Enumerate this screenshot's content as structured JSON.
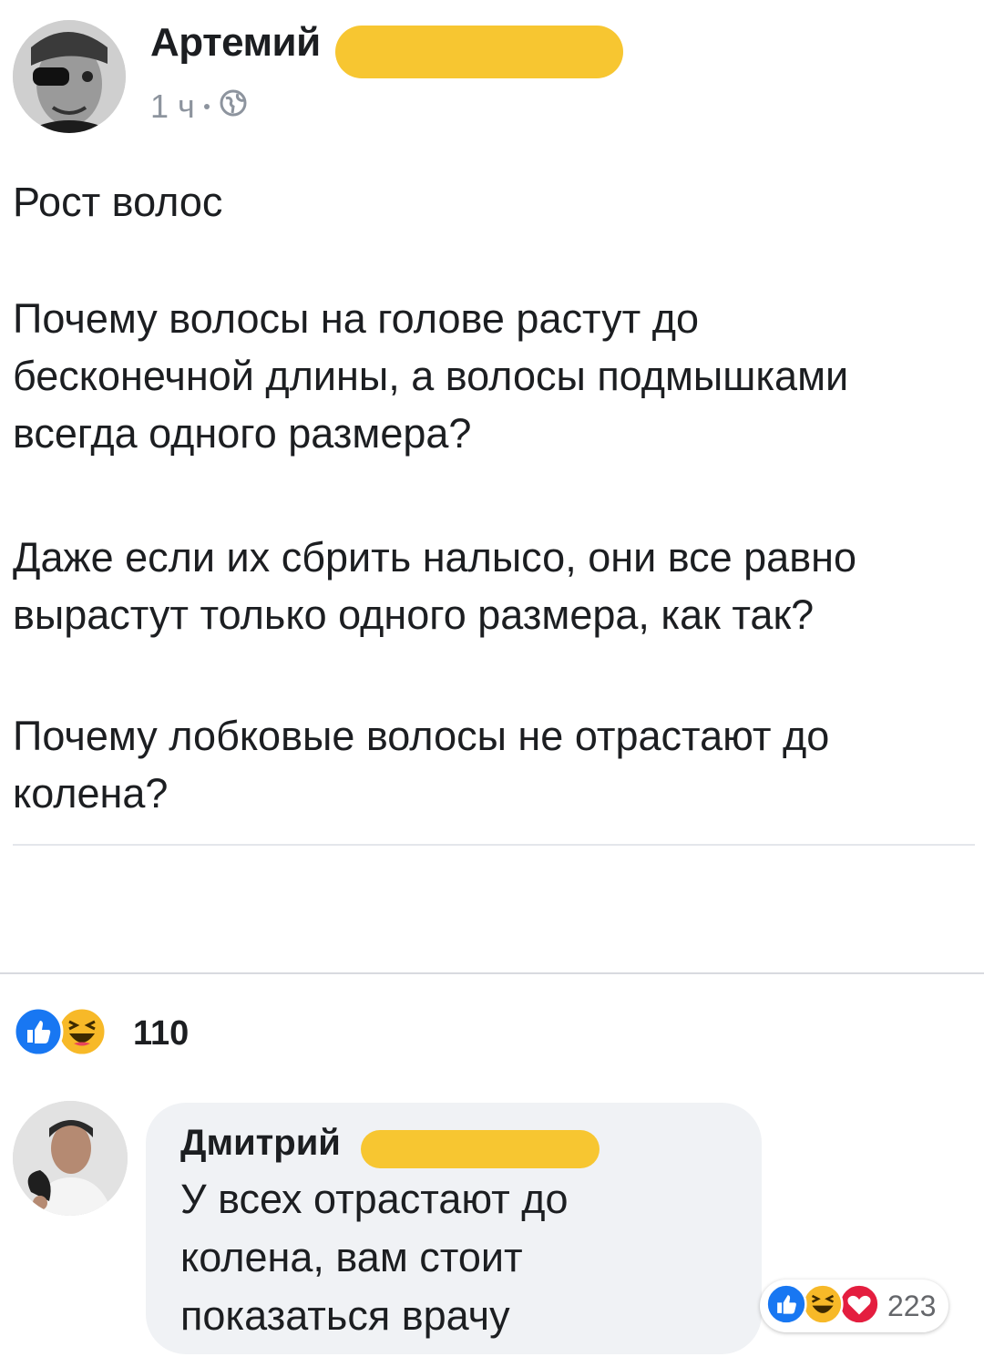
{
  "post": {
    "author": "Артемий",
    "time": "1 ч",
    "title": "Рост волос",
    "paragraphs": [
      "Почему волосы на голове растут до\nбесконечной длины, а волосы подмышками\nвсегда одного размера?",
      "Даже если их сбрить налысо, они все равно\nвырастут только одного размера, как так?",
      "Почему лобковые волосы не отрастают до\nколена?"
    ],
    "reaction_count": "110",
    "reaction_icons": [
      "like-icon",
      "haha-icon"
    ]
  },
  "comment": {
    "author": "Дмитрий",
    "text": "У всех отрастают до\nколена, вам стоит\nпоказаться врачу",
    "reaction_count": "223",
    "reaction_icons": [
      "like-icon",
      "haha-icon",
      "love-icon"
    ]
  },
  "colors": {
    "redaction": "#f7c631",
    "like_blue": "#1877f2",
    "haha_yellow": "#f7b928",
    "love_red": "#e41e3f",
    "bubble_bg": "#f0f2f5"
  }
}
